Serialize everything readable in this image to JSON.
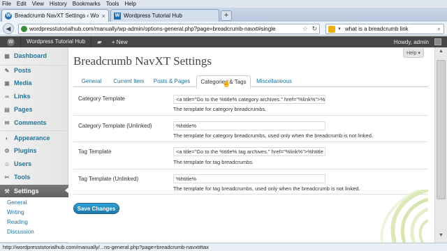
{
  "browser": {
    "menu": [
      "File",
      "Edit",
      "View",
      "History",
      "Bookmarks",
      "Tools",
      "Help"
    ],
    "tabs": [
      {
        "title": "Breadcrumb NavXT Settings ‹ Wordpr...",
        "close": "×"
      },
      {
        "title": "Wordpress Tutorial Hub"
      }
    ],
    "new_tab": "+",
    "url": "wordpresstutorialhub.com/manually/wp-admin/options-general.php?page=breadcrumb-navxt#single",
    "search_query": "what is a breadcrumb link",
    "status_url": "http://wordpresstutorialhub.com/manually/...ns-general.php?page=breadcrumb-navxt#tax"
  },
  "adminbar": {
    "site_name": "Wordpress Tutorial Hub",
    "new_label": "New",
    "howdy": "Howdy, admin"
  },
  "sidebar": {
    "items": [
      {
        "label": "Dashboard",
        "icon": "dashboard-icon"
      },
      {
        "label": "Posts",
        "icon": "posts-icon"
      },
      {
        "label": "Media",
        "icon": "media-icon"
      },
      {
        "label": "Links",
        "icon": "links-icon"
      },
      {
        "label": "Pages",
        "icon": "pages-icon"
      },
      {
        "label": "Comments",
        "icon": "comments-icon"
      },
      {
        "label": "Appearance",
        "icon": "appearance-icon"
      },
      {
        "label": "Plugins",
        "icon": "plugins-icon"
      },
      {
        "label": "Users",
        "icon": "users-icon"
      },
      {
        "label": "Tools",
        "icon": "tools-icon"
      },
      {
        "label": "Settings",
        "icon": "settings-icon"
      }
    ],
    "submenu": [
      "General",
      "Writing",
      "Reading",
      "Discussion"
    ]
  },
  "main": {
    "help": "Help ▾",
    "title": "Breadcrumb NavXT Settings",
    "tabs": [
      "General",
      "Current Item",
      "Posts & Pages",
      "Categories & Tags",
      "Miscellaneous"
    ],
    "active_tab": "Categories & Tags",
    "rows": [
      {
        "label": "Category Template",
        "value": "<a title=\"Go to the %title% category archives.\" href=\"%link%\">%",
        "desc": "The template for category breadcrumbs."
      },
      {
        "label": "Category Template (Unlinked)",
        "value": "%htitle%",
        "desc": "The template for category breadcrumbs, used only when the breadcrumb is not linked."
      },
      {
        "label": "Tag Template",
        "value": "<a title=\"Go to the %title% tag archives.\" href=\"%link%\">%htitle",
        "desc": "The template for tag breadcrumbs."
      },
      {
        "label": "Tag Template (Unlinked)",
        "value": "%htitle%",
        "desc": "The template for tag breadcrumbs, used only when the breadcrumb is not linked."
      }
    ],
    "save_label": "Save Changes"
  },
  "colors": {
    "link": "#21759b",
    "adminbar": "#464646",
    "primary_button": "#2e9fd2"
  }
}
